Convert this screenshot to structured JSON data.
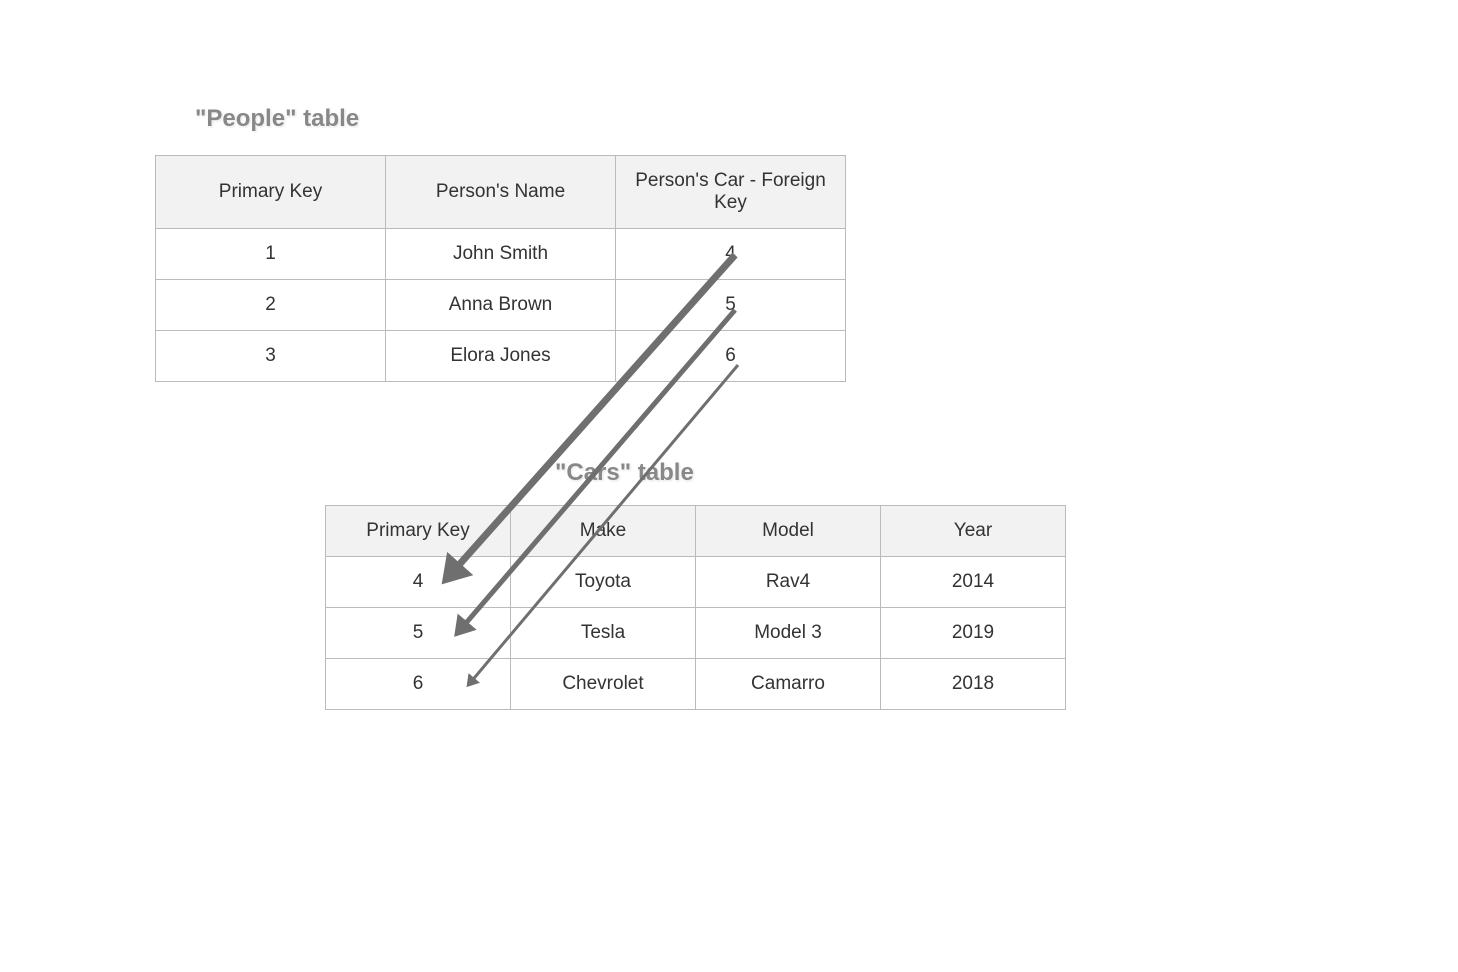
{
  "peopleTable": {
    "title": "\"People\" table",
    "headers": {
      "pk": "Primary Key",
      "name": "Person's Name",
      "fk": "Person's Car - Foreign Key"
    },
    "rows": [
      {
        "pk": "1",
        "name": "John Smith",
        "fk": "4"
      },
      {
        "pk": "2",
        "name": "Anna Brown",
        "fk": "5"
      },
      {
        "pk": "3",
        "name": "Elora Jones",
        "fk": "6"
      }
    ]
  },
  "carsTable": {
    "title": "\"Cars\" table",
    "headers": {
      "pk": "Primary Key",
      "make": "Make",
      "model": "Model",
      "year": "Year"
    },
    "rows": [
      {
        "pk": "4",
        "make": "Toyota",
        "model": "Rav4",
        "year": "2014"
      },
      {
        "pk": "5",
        "make": "Tesla",
        "model": "Model 3",
        "year": "2019"
      },
      {
        "pk": "6",
        "make": "Chevrolet",
        "model": "Camarro",
        "year": "2018"
      }
    ]
  }
}
